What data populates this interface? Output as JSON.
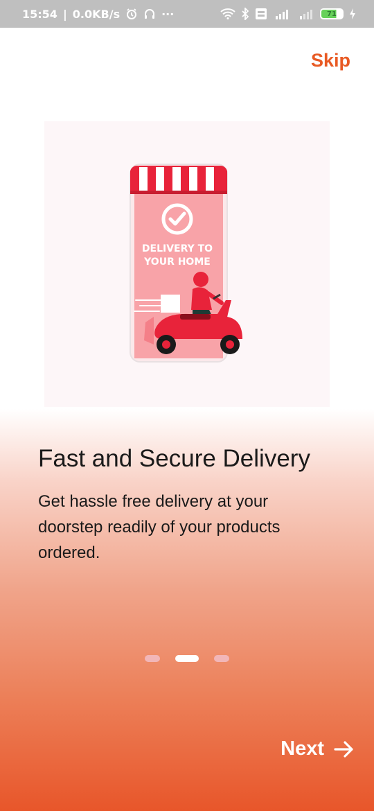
{
  "status_bar": {
    "time": "15:54",
    "network_speed": "0.0KB/s",
    "more": "···",
    "net_label": "4G",
    "battery_level": "71"
  },
  "header": {
    "skip_label": "Skip"
  },
  "illustration": {
    "caption_line1": "DELIVERY TO",
    "caption_line2": "YOUR HOME"
  },
  "content": {
    "title": "Fast and Secure Delivery",
    "description": "Get hassle free delivery at your doorstep readily of your products ordered."
  },
  "pager": {
    "count": 3,
    "active_index": 1
  },
  "footer": {
    "next_label": "Next"
  },
  "colors": {
    "accent": "#e85a24",
    "gradient_bottom": "#e8562a",
    "awning_red": "#e8233a",
    "phone_screen": "#f8a3a8"
  }
}
